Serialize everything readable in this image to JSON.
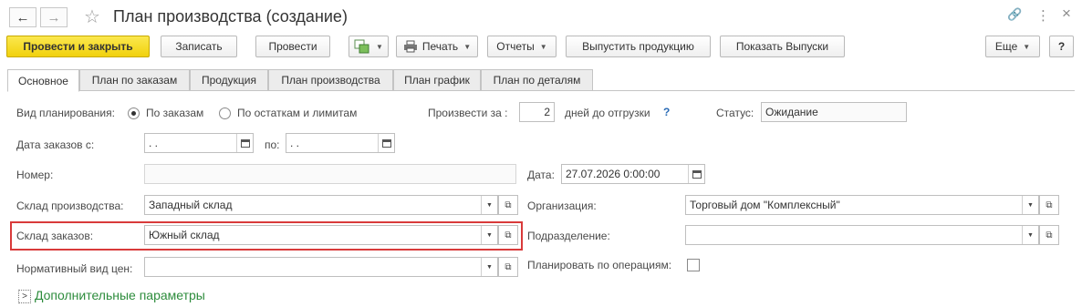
{
  "window": {
    "title": "План производства (создание)",
    "back_glyph": "←",
    "forward_glyph": "→",
    "star_glyph": "☆",
    "link_glyph": "🔗",
    "more_glyph": "⋮",
    "close_glyph": "×"
  },
  "toolbar": {
    "post_close": "Провести и закрыть",
    "save": "Записать",
    "post": "Провести",
    "print": "Печать",
    "reports": "Отчеты",
    "release": "Выпустить продукцию",
    "show_releases": "Показать Выпуски",
    "more": "Еще",
    "help": "?"
  },
  "tabs": [
    "Основное",
    "План по заказам",
    "Продукция",
    "План производства",
    "План график",
    "План по деталям"
  ],
  "form": {
    "planning_type_label": "Вид планирования:",
    "radio_orders": "По заказам",
    "radio_stock": "По остаткам и лимитам",
    "produce_for_label": "Произвести за :",
    "produce_days": "2",
    "days_suffix": "дней до отгрузки",
    "help_mark": "?",
    "status_label": "Статус:",
    "status_value": "Ожидание",
    "orders_date_from_label": "Дата заказов с:",
    "date_from": " .  .",
    "date_to_label": "по:",
    "date_to": " .  .",
    "number_label": "Номер:",
    "number_value": "",
    "date_label": "Дата:",
    "date_value": "27.07.2026  0:00:00",
    "warehouse_label": "Склад производства:",
    "warehouse_value": "Западный склад",
    "organization_label": "Организация:",
    "organization_value": "Торговый дом \"Комплексный\"",
    "orders_warehouse_label": "Склад заказов:",
    "orders_warehouse_value": "Южный склад",
    "department_label": "Подразделение:",
    "department_value": "",
    "price_type_label": "Нормативный вид цен:",
    "price_type_value": "",
    "plan_by_ops_label": "Планировать по операциям:",
    "additional_params": "Дополнительные параметры"
  },
  "colors": {
    "primary_button": "#f1d10d",
    "highlight_border": "#d93a3a",
    "link_green": "#2d8c3c"
  }
}
